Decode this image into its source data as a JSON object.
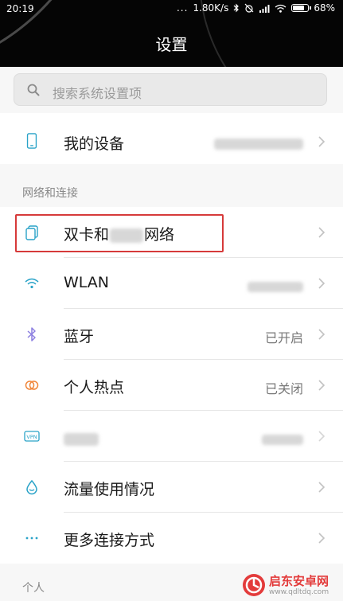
{
  "status_bar": {
    "time": "20:19",
    "dots": "...",
    "speed": "1.80K/s",
    "battery": "68%"
  },
  "header": {
    "title": "设置"
  },
  "search": {
    "placeholder": "搜索系统设置项",
    "icon": "search-icon"
  },
  "device": {
    "label": "我的设备",
    "icon": "phone-icon"
  },
  "sections": {
    "network": "网络和连接",
    "personal": "个人"
  },
  "network_items": [
    {
      "label_prefix": "双卡和",
      "label_suffix": "网络",
      "icon": "sim-cards-icon"
    },
    {
      "label": "WLAN",
      "icon": "wifi-icon"
    },
    {
      "label": "蓝牙",
      "value": "已开启",
      "icon": "bluetooth-icon"
    },
    {
      "label": "个人热点",
      "value": "已关闭",
      "icon": "hotspot-icon"
    },
    {
      "icon": "vpn-icon",
      "icon_text": "VPN"
    },
    {
      "label": "流量使用情况",
      "icon": "data-drop-icon"
    },
    {
      "label": "更多连接方式",
      "icon": "more-dots-icon"
    }
  ],
  "watermark": {
    "main": "启东安卓网",
    "sub": "www.qdltdq.com"
  },
  "colors": {
    "accent_blue": "#2aa3c8",
    "highlight_red": "#d63a3a",
    "header_bg": "#050505"
  }
}
